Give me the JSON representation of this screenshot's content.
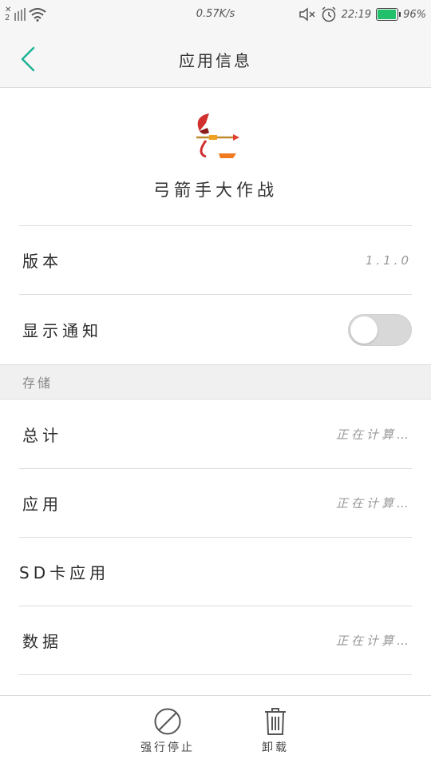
{
  "status_bar": {
    "sim_label": "2",
    "net_speed": "0.57K/s",
    "time": "22:19",
    "battery_pct": "96%",
    "battery_level": 0.96
  },
  "header": {
    "title": "应用信息"
  },
  "app": {
    "name": "弓箭手大作战"
  },
  "rows": {
    "version_label": "版本",
    "version_value": "1.1.0",
    "notify_label": "显示通知"
  },
  "storage": {
    "section_label": "存储",
    "total_label": "总计",
    "total_value": "正在计算…",
    "app_label": "应用",
    "app_value": "正在计算…",
    "sd_label": "SD卡应用",
    "data_label": "数据",
    "data_value": "正在计算…"
  },
  "bottom": {
    "force_stop_label": "强行停止",
    "uninstall_label": "卸载"
  },
  "colors": {
    "accent": "#1db394",
    "toggle_off": "#d8d8d8",
    "battery": "#22c06a"
  }
}
